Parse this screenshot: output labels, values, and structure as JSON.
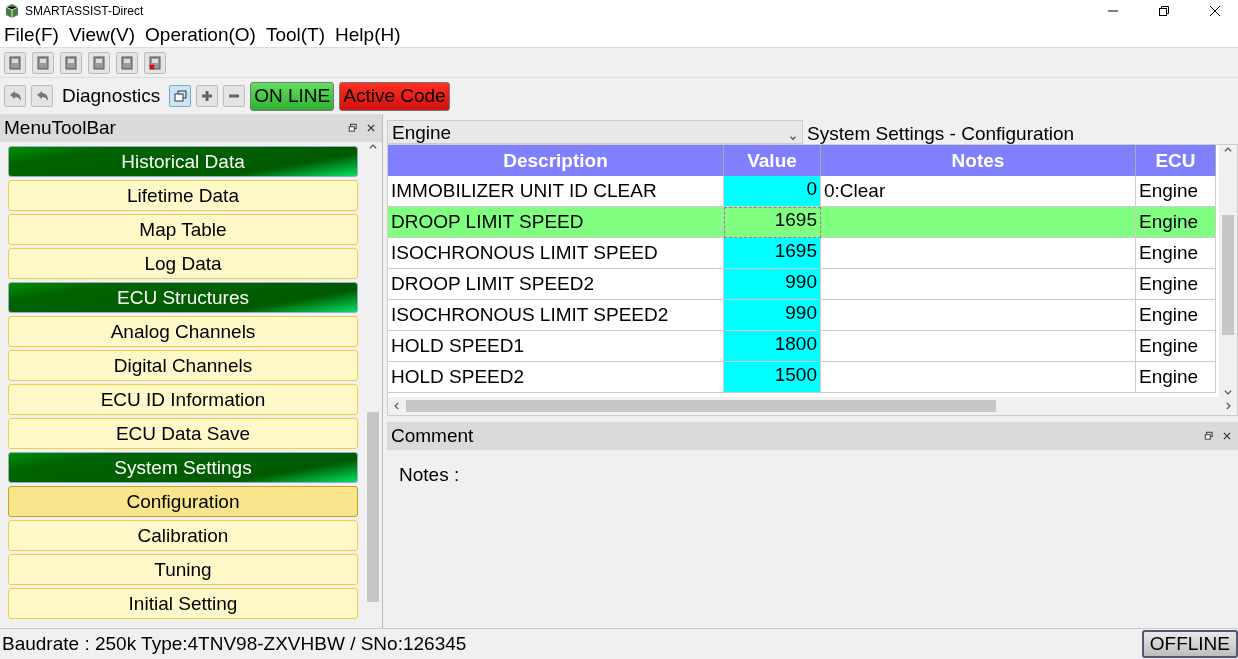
{
  "window": {
    "title": "SMARTASSIST-Direct"
  },
  "menu": [
    "File(F)",
    "View(V)",
    "Operation(O)",
    "Tool(T)",
    "Help(H)"
  ],
  "toolbar2": {
    "label": "Diagnostics",
    "online": "ON LINE",
    "active_code": "Active Code"
  },
  "sidebar": {
    "title": "MenuToolBar",
    "items": [
      {
        "kind": "header",
        "label": "Historical Data"
      },
      {
        "kind": "item",
        "label": "Lifetime Data",
        "selected": false
      },
      {
        "kind": "item",
        "label": "Map Table",
        "selected": false
      },
      {
        "kind": "item",
        "label": "Log Data",
        "selected": false
      },
      {
        "kind": "header",
        "label": "ECU Structures"
      },
      {
        "kind": "item",
        "label": "Analog Channels",
        "selected": false
      },
      {
        "kind": "item",
        "label": "Digital Channels",
        "selected": false
      },
      {
        "kind": "item",
        "label": "ECU ID Information",
        "selected": false
      },
      {
        "kind": "item",
        "label": "ECU Data Save",
        "selected": false
      },
      {
        "kind": "header",
        "label": "System Settings"
      },
      {
        "kind": "item",
        "label": "Configuration",
        "selected": true
      },
      {
        "kind": "item",
        "label": "Calibration",
        "selected": false
      },
      {
        "kind": "item",
        "label": "Tuning",
        "selected": false
      },
      {
        "kind": "item",
        "label": "Initial Setting",
        "selected": false
      }
    ]
  },
  "ecu_select": {
    "value": "Engine"
  },
  "page_title": "System Settings - Configuration",
  "table": {
    "columns": [
      "Description",
      "Value",
      "Notes",
      "ECU"
    ],
    "rows": [
      {
        "cells": [
          "IMMOBILIZER UNIT ID CLEAR",
          "0",
          "0:Clear",
          "Engine"
        ],
        "selected": false
      },
      {
        "cells": [
          "DROOP LIMIT SPEED",
          "1695",
          "",
          "Engine"
        ],
        "selected": true
      },
      {
        "cells": [
          "ISOCHRONOUS LIMIT SPEED",
          "1695",
          "",
          "Engine"
        ],
        "selected": false
      },
      {
        "cells": [
          "DROOP LIMIT SPEED2",
          "990",
          "",
          "Engine"
        ],
        "selected": false
      },
      {
        "cells": [
          "ISOCHRONOUS LIMIT SPEED2",
          "990",
          "",
          "Engine"
        ],
        "selected": false
      },
      {
        "cells": [
          "HOLD SPEED1",
          "1800",
          "",
          "Engine"
        ],
        "selected": false
      },
      {
        "cells": [
          "HOLD SPEED2",
          "1500",
          "",
          "Engine"
        ],
        "selected": false
      }
    ]
  },
  "comment": {
    "title": "Comment",
    "notes_label": "Notes :"
  },
  "status_bar": {
    "text": "Baudrate : 250k Type:4TNV98-ZXVHBW / SNo:126345",
    "connection": "OFFLINE"
  }
}
